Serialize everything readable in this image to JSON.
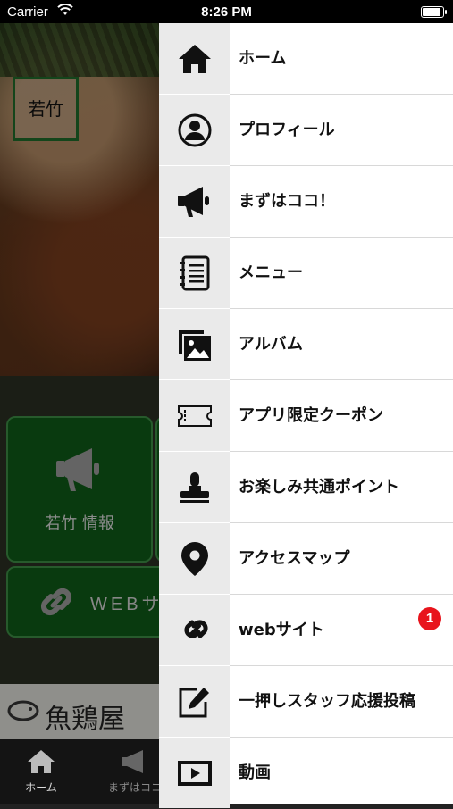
{
  "status_bar": {
    "carrier": "Carrier",
    "time": "8:26 PM"
  },
  "background_app": {
    "logo_text": "若竹",
    "info_card_label": "若竹 情報",
    "web_card_label": "WEBサ",
    "banner_text": "魚鶏屋",
    "tabs": [
      {
        "label": "ホーム",
        "icon": "home-icon"
      },
      {
        "label": "まずはココ",
        "icon": "megaphone-icon"
      }
    ]
  },
  "menu": {
    "items": [
      {
        "label": "ホーム",
        "icon": "home-icon"
      },
      {
        "label": "プロフィール",
        "icon": "profile-icon"
      },
      {
        "label": "まずはココ！",
        "icon": "megaphone-icon"
      },
      {
        "label": "メニュー",
        "icon": "notebook-icon"
      },
      {
        "label": "アルバム",
        "icon": "album-icon"
      },
      {
        "label": "アプリ限定クーポン",
        "icon": "coupon-icon"
      },
      {
        "label": "お楽しみ共通ポイント",
        "icon": "stamp-icon"
      },
      {
        "label": "アクセスマップ",
        "icon": "map-pin-icon"
      },
      {
        "label": "webサイト",
        "icon": "link-icon",
        "badge": "1"
      },
      {
        "label": "一押しスタッフ応援投稿",
        "icon": "edit-icon"
      },
      {
        "label": "動画",
        "icon": "video-icon"
      }
    ]
  },
  "colors": {
    "accent_green": "#0f5a17",
    "badge_red": "#e8141c",
    "icon_cell_bg": "#eaeaea"
  }
}
